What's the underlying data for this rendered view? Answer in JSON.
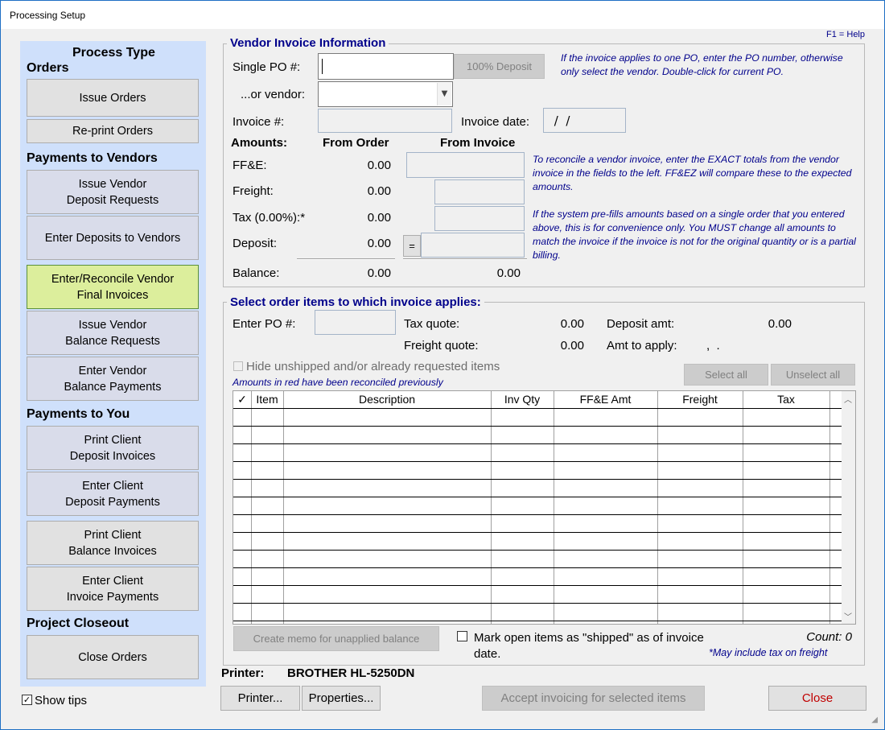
{
  "window": {
    "title": "Processing Setup",
    "help": "F1 = Help"
  },
  "left": {
    "process_type": "Process Type",
    "orders_title": "Orders",
    "issue_orders": "Issue Orders",
    "reprint_orders": "Re-print Orders",
    "payments_vendors_title": "Payments to Vendors",
    "issue_vendor_deposit_l1": "Issue Vendor",
    "issue_vendor_deposit_l2": "Deposit Requests",
    "enter_deposits_vendors": "Enter Deposits to Vendors",
    "reconcile_l1": "Enter/Reconcile Vendor",
    "reconcile_l2": "Final Invoices",
    "issue_balance_l1": "Issue Vendor",
    "issue_balance_l2": "Balance Requests",
    "enter_balance_l1": "Enter Vendor",
    "enter_balance_l2": "Balance Payments",
    "payments_you_title": "Payments to You",
    "print_deposit_l1": "Print Client",
    "print_deposit_l2": "Deposit Invoices",
    "enter_deposit_l1": "Enter Client",
    "enter_deposit_l2": "Deposit Payments",
    "print_balance_l1": "Print Client",
    "print_balance_l2": "Balance Invoices",
    "enter_invoice_l1": "Enter Client",
    "enter_invoice_l2": "Invoice Payments",
    "closeout_title": "Project Closeout",
    "close_orders": "Close Orders",
    "show_tips": "Show tips",
    "show_tips_checked": true
  },
  "vendor_invoice": {
    "title": "Vendor Invoice Information",
    "single_po_label": "Single PO #:",
    "single_po_value": "",
    "deposit_100": "100% Deposit",
    "or_vendor_label": "...or vendor:",
    "vendor_value": "",
    "invoice_num_label": "Invoice #:",
    "invoice_date_label": "Invoice date:",
    "invoice_date_value": " /  /",
    "po_tip": "If the invoice applies to one PO, enter the PO number, otherwise only select the vendor. Double-click for current PO.",
    "amounts_label": "Amounts:",
    "from_order_label": "From Order",
    "from_invoice_label": "From Invoice",
    "ffe_label": "FF&E:",
    "ffe_order": "0.00",
    "freight_label": "Freight:",
    "freight_order": "0.00",
    "tax_label": "Tax (0.00%):*",
    "tax_order": "0.00",
    "deposit_label": "Deposit:",
    "deposit_order": "0.00",
    "deposit_eq": "=",
    "balance_label": "Balance:",
    "balance_order": "0.00",
    "balance_invoice": "0.00",
    "reconcile_tip": "To reconcile a vendor invoice, enter the EXACT totals from the vendor invoice in the fields to the left. FF&EZ will compare these to the expected amounts.",
    "prefill_tip": "If the system pre-fills amounts based on a single order that you entered above, this is for convenience only. You MUST change all amounts to match the invoice if the invoice is not for the original quantity or is a partial billing."
  },
  "order_items": {
    "title": "Select order items to which invoice applies:",
    "enter_po_label": "Enter PO #:",
    "tax_quote_label": "Tax quote:",
    "tax_quote_value": "0.00",
    "freight_quote_label": "Freight quote:",
    "freight_quote_value": "0.00",
    "deposit_amt_label": "Deposit amt:",
    "deposit_amt_value": "0.00",
    "amt_to_apply_label": "Amt to apply:",
    "amt_to_apply_value": ",  .",
    "hide_unshipped": "Hide unshipped and/or already requested items",
    "red_note": "Amounts in red have been reconciled previously",
    "select_all": "Select all",
    "unselect_all": "Unselect all",
    "columns": [
      "✓",
      "Item",
      "Description",
      "Inv Qty",
      "FF&E Amt",
      "Freight",
      "Tax"
    ],
    "create_memo": "Create memo for unapplied balance",
    "mark_open": "Mark open items as \"shipped\" as of invoice date.",
    "count": "Count: 0",
    "tax_note": "*May include tax on freight"
  },
  "footer": {
    "printer_label": "Printer:",
    "printer_value": "BROTHER HL-5250DN",
    "printer_btn": "Printer...",
    "properties_btn": "Properties...",
    "accept_btn": "Accept invoicing for selected items",
    "close_btn": "Close",
    "close_color": "#c00000"
  }
}
